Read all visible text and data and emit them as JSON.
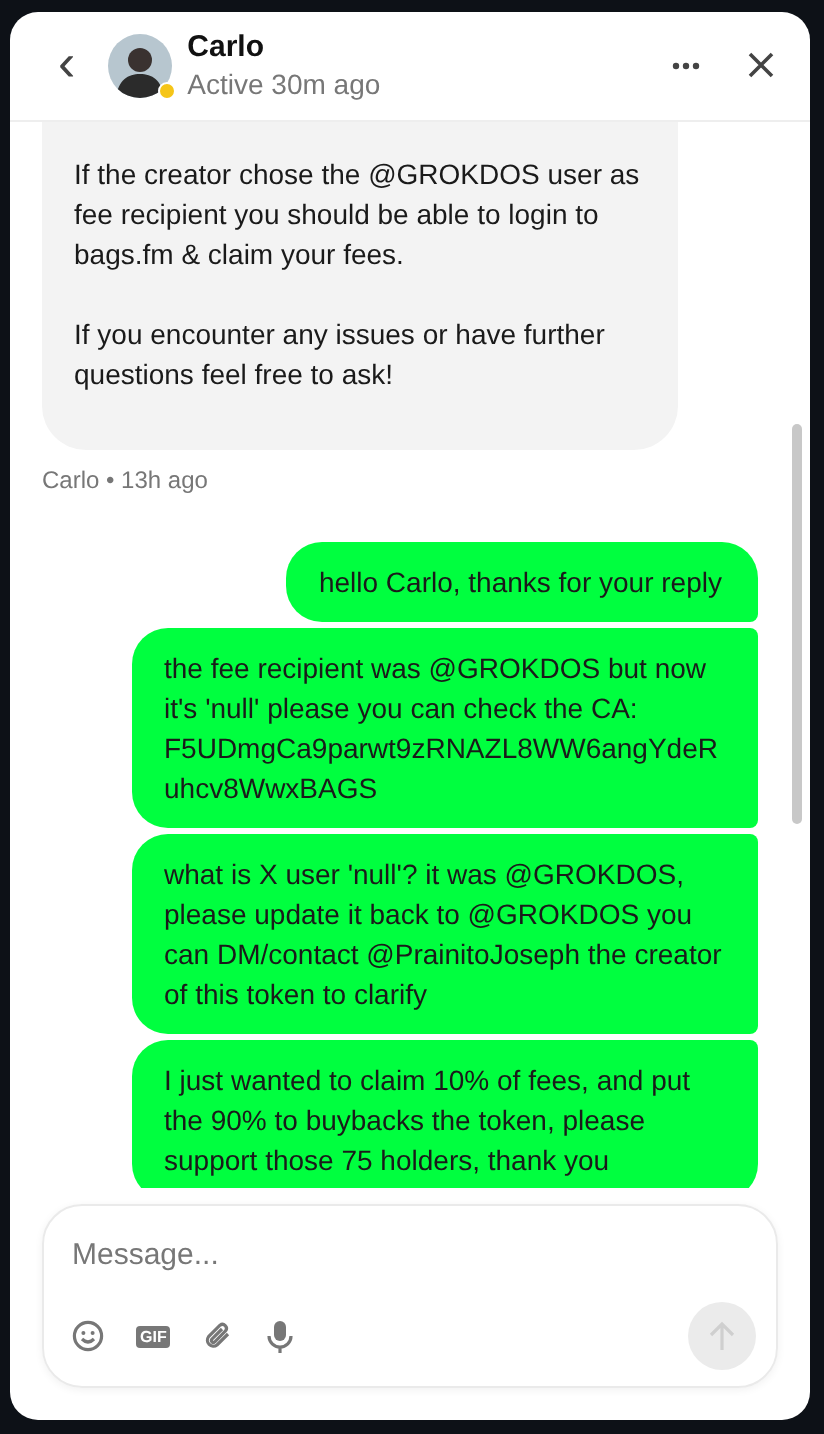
{
  "header": {
    "back": "‹",
    "name": "Carlo",
    "away": true,
    "activity": "Active 30m ago"
  },
  "messages": [
    {
      "from_me": false,
      "text": "If the creator chose the @GROKDOS user as fee recipient you should be able to login to bags.fm & claim your fees.\n\nIf you encounter any issues or have further questions feel free to ask!",
      "meta": "Carlo • 13h ago"
    },
    {
      "from_me": true,
      "text": "hello Carlo, thanks for your reply"
    },
    {
      "from_me": true,
      "text": "the fee recipient was @GROKDOS but now it's 'null' please you can check the CA: F5UDmgCa9parwt9zRNAZL8WW6angYdeRuhcv8WwxBAGS"
    },
    {
      "from_me": true,
      "text": "what is X user 'null'? it was @GROKDOS, please update it back to @GROKDOS you can DM/contact @PrainitoJoseph the creator of this token to clarify"
    },
    {
      "from_me": true,
      "text": "I just wanted to claim 10% of fees, and put the 90% to buybacks the token, please support those 75 holders, thank you"
    }
  ],
  "composer": {
    "placeholder": "Message...",
    "gif_label": "GIF",
    "send_disabled": true
  }
}
